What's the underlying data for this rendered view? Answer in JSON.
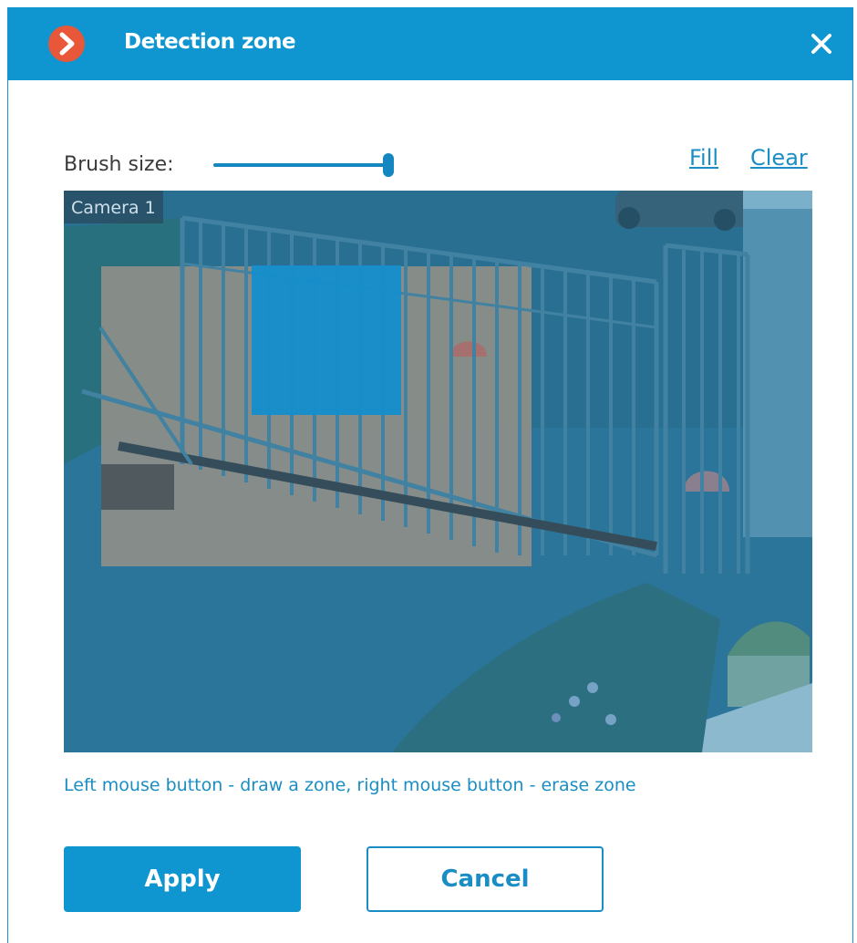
{
  "dialog": {
    "title": "Detection zone",
    "logo_icon": "app-logo-chevron-icon",
    "close_icon": "close-icon"
  },
  "toolbar": {
    "brush_label": "Brush size:",
    "brush_value": 1.0,
    "fill_label": "Fill",
    "clear_label": "Clear"
  },
  "camera": {
    "label": "Camera 1"
  },
  "hint": "Left mouse button - draw a zone, right mouse button - erase zone",
  "buttons": {
    "apply": "Apply",
    "cancel": "Cancel"
  },
  "colors": {
    "accent": "#0f95cf",
    "logo": "#e8573a",
    "link": "#1a8ec4",
    "zone_overlay": "#1b8fcc"
  }
}
